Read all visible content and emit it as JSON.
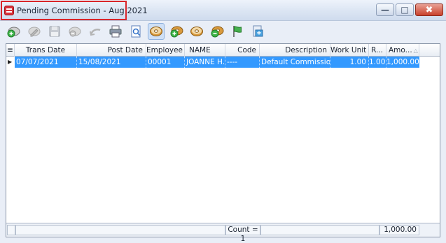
{
  "window": {
    "title": "Pending Commission - Aug 2021"
  },
  "window_buttons": {
    "minimize": "—",
    "maximize": "□",
    "close": "✖"
  },
  "toolbar": [
    {
      "name": "add-record-icon"
    },
    {
      "name": "edit-record-icon"
    },
    {
      "name": "save-icon"
    },
    {
      "name": "delete-record-icon"
    },
    {
      "name": "undo-icon"
    },
    {
      "name": "print-icon"
    },
    {
      "name": "preview-icon"
    },
    {
      "name": "donut-commission-icon"
    },
    {
      "name": "donut-add-icon"
    },
    {
      "name": "donut-plain-icon"
    },
    {
      "name": "donut-remove-icon"
    },
    {
      "name": "flag-icon"
    },
    {
      "name": "export-icon"
    }
  ],
  "grid": {
    "columns": [
      "Trans Date",
      "Post Date",
      "Employee",
      "NAME",
      "Code",
      "Description",
      "Work Unit",
      "R...",
      "Amo..."
    ],
    "rows": [
      [
        "07/07/2021",
        "15/08/2021",
        "00001",
        "JOANNE H...",
        "----",
        "Default Commission",
        "1.00",
        "1.00",
        "1,000.00"
      ]
    ],
    "footer": {
      "count": "Count = 1",
      "total": "1,000.00"
    }
  },
  "colors": {
    "selection": "#3399ff",
    "highlight_box": "#d9262b"
  }
}
